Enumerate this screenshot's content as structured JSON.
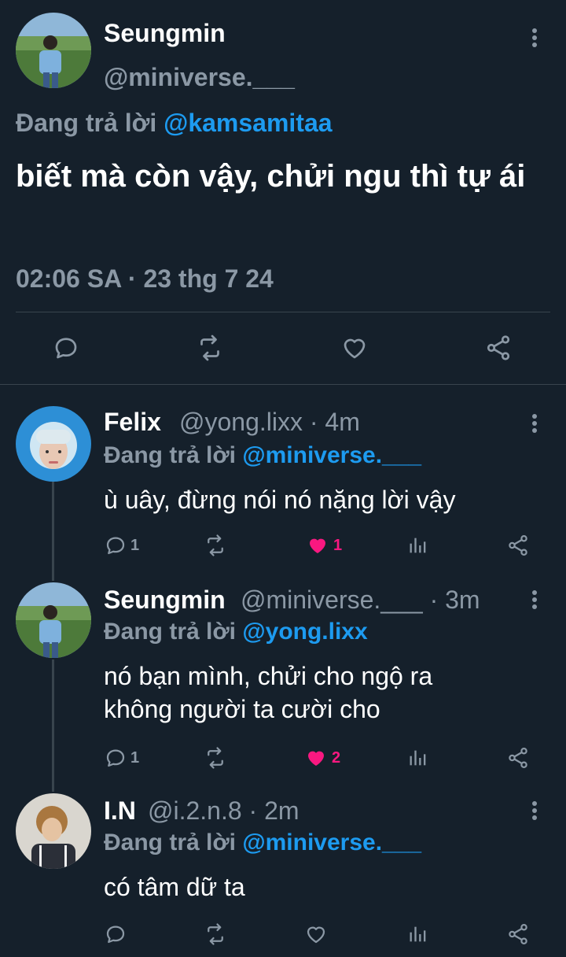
{
  "colors": {
    "background": "#15202b",
    "text": "#ffffff",
    "muted": "#8b98a5",
    "link": "#1d9bf0",
    "like": "#f91880",
    "divider": "#38444d"
  },
  "main_tweet": {
    "name": "Seungmin",
    "handle": "@miniverse.___",
    "reply_prefix": "Đang trả lời",
    "reply_to": "@kamsamitaa",
    "text": "biết mà còn vậy, chửi ngu thì tự ái",
    "timestamp": "02:06 SA · 23 thg 7 24",
    "actions": [
      "reply-icon",
      "retweet-icon",
      "like-icon",
      "share-icon"
    ]
  },
  "replies": [
    {
      "name": "Felix",
      "handle": "@yong.lixx",
      "time": "· 4m",
      "reply_prefix": "Đang trả lời",
      "reply_to": "@miniverse.___",
      "text": "ù uây, đừng nói nó nặng lời vậy",
      "reply_count": "1",
      "like_count": "1",
      "liked": true
    },
    {
      "name": "Seungmin",
      "handle": "@miniverse.___",
      "time": "· 3m",
      "reply_prefix": "Đang trả lời",
      "reply_to": "@yong.lixx",
      "text": "nó bạn mình, chửi cho ngộ ra không người ta cười cho",
      "reply_count": "1",
      "like_count": "2",
      "liked": true
    },
    {
      "name": "I.N",
      "handle": "@i.2.n.8",
      "time": "· 2m",
      "reply_prefix": "Đang trả lời",
      "reply_to": "@miniverse.___",
      "text": "có tâm dữ ta",
      "reply_count": "",
      "like_count": "",
      "liked": false
    }
  ]
}
